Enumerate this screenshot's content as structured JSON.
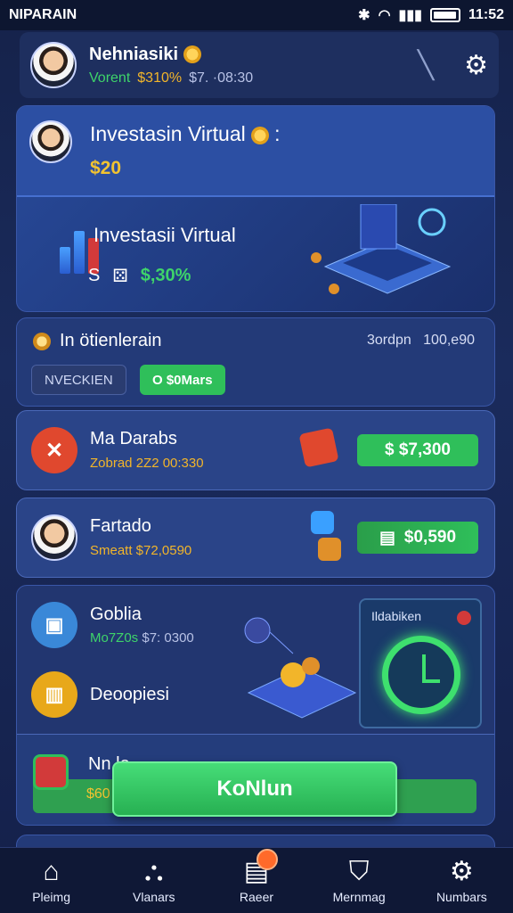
{
  "status": {
    "carrier": "NIPARAIN",
    "time": "11:52"
  },
  "header": {
    "name": "Nehniasiki",
    "sub_label": "Vorent",
    "sub_value1": "$310%",
    "sub_value2": "$7. ·08:30"
  },
  "hero": {
    "title": "Investasin Virtual",
    "value": "$20",
    "title2": "Investasii Virtual",
    "row_s": "S",
    "row_val": "$,30%"
  },
  "section": {
    "title": "In ötienlerain",
    "right_a": "3ordpn",
    "right_b": "100,e90",
    "pill1": "NVECKIEN",
    "pill2": "O $0Mars"
  },
  "rows": [
    {
      "name": "Ma Darabs",
      "sub": "Zobrad 2Z2 00:330",
      "btn": "$  $7,300",
      "color": "#e0482e"
    },
    {
      "name": "Fartado",
      "sub": "Smeatt $72,0590",
      "btn": "$0,590"
    }
  ],
  "group": {
    "item1_name": "Goblia",
    "item1_sub_a": "Mo7Z0s",
    "item1_sub_b": "$7: 0300",
    "item2_name": "Deoopiesi",
    "timer_label": "Ildabiken",
    "bottom_name": "Nn le",
    "bottom_val": "$60"
  },
  "cta": "KoNlun",
  "nav": [
    {
      "label": "Pleimg",
      "icon": "home-icon"
    },
    {
      "label": "Vlanars",
      "icon": "chart-icon"
    },
    {
      "label": "Raeer",
      "icon": "document-icon"
    },
    {
      "label": "Mernmag",
      "icon": "shield-icon"
    },
    {
      "label": "Numbars",
      "icon": "gear-icon"
    }
  ],
  "colors": {
    "accent": "#2fbf5a",
    "gold": "#f2c330",
    "bg": "#1a2b5c"
  }
}
